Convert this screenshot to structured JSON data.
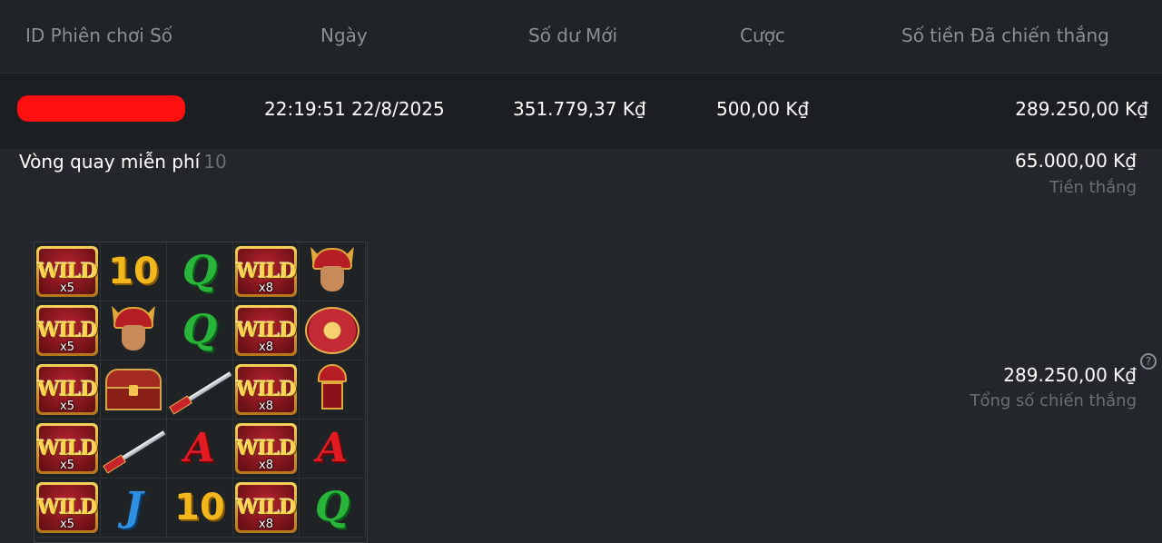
{
  "header": {
    "col_id": "ID Phiên chơi Số",
    "col_date": "Ngày",
    "col_balance": "Số dư Mới",
    "col_bet": "Cược",
    "col_win": "Số tiền Đã chiến thắng"
  },
  "record": {
    "date": "22:19:51 22/8/2025",
    "balance": "351.779,37 K₫",
    "bet": "500,00 K₫",
    "win": "289.250,00 K₫"
  },
  "free_spins": {
    "label": "Vòng quay miễn phí",
    "count": "10",
    "win_amount": "65.000,00 K₫",
    "win_label": "Tiền thắng"
  },
  "total": {
    "amount": "289.250,00 K₫",
    "label": "Tổng số chiến thắng",
    "help": "?"
  },
  "colors": {
    "background": "#23272b",
    "header_bg": "#202427",
    "row_bg": "#1c1f22",
    "redaction": "#ff1010",
    "muted_text": "#6a6f75"
  },
  "reels": {
    "rows": [
      [
        {
          "sym": "wild",
          "mult": "x5"
        },
        {
          "sym": "10"
        },
        {
          "sym": "Q"
        },
        {
          "sym": "wild",
          "mult": "x8"
        },
        {
          "sym": "samurai"
        }
      ],
      [
        {
          "sym": "wild",
          "mult": "x5"
        },
        {
          "sym": "samurai"
        },
        {
          "sym": "Q"
        },
        {
          "sym": "wild",
          "mult": "x8"
        },
        {
          "sym": "fan"
        }
      ],
      [
        {
          "sym": "wild",
          "mult": "x5"
        },
        {
          "sym": "chest"
        },
        {
          "sym": "sword"
        },
        {
          "sym": "wild",
          "mult": "x8"
        },
        {
          "sym": "armor"
        }
      ],
      [
        {
          "sym": "wild",
          "mult": "x5"
        },
        {
          "sym": "sword"
        },
        {
          "sym": "A"
        },
        {
          "sym": "wild",
          "mult": "x8"
        },
        {
          "sym": "A"
        }
      ],
      [
        {
          "sym": "wild",
          "mult": "x5"
        },
        {
          "sym": "J"
        },
        {
          "sym": "10"
        },
        {
          "sym": "wild",
          "mult": "x8"
        },
        {
          "sym": "Q"
        }
      ]
    ],
    "wild_text": "WILD"
  }
}
